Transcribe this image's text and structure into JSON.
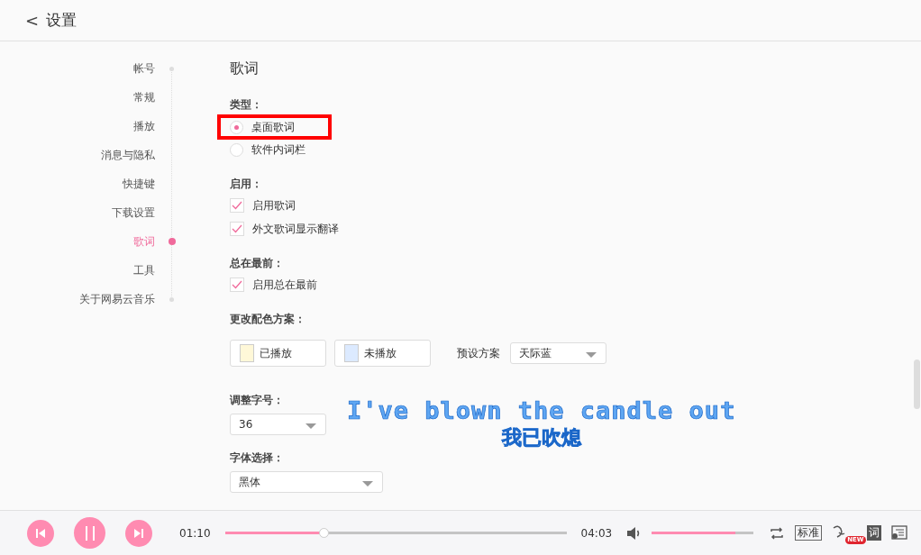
{
  "header": {
    "back": "<",
    "title": "设置"
  },
  "sidebar": {
    "items": [
      {
        "label": "帐号",
        "selected": false
      },
      {
        "label": "常规",
        "selected": false
      },
      {
        "label": "播放",
        "selected": false
      },
      {
        "label": "消息与隐私",
        "selected": false
      },
      {
        "label": "快捷键",
        "selected": false
      },
      {
        "label": "下载设置",
        "selected": false
      },
      {
        "label": "歌词",
        "selected": true
      },
      {
        "label": "工具",
        "selected": false
      },
      {
        "label": "关于网易云音乐",
        "selected": false
      }
    ]
  },
  "section_title": "歌词",
  "type_group": {
    "label": "类型：",
    "options": [
      {
        "label": "桌面歌词",
        "selected": true,
        "highlighted": true
      },
      {
        "label": "软件内词栏",
        "selected": false,
        "highlighted": false
      }
    ]
  },
  "enable_group": {
    "label": "启用：",
    "options": [
      {
        "label": "启用歌词",
        "checked": true
      },
      {
        "label": "外文歌词显示翻译",
        "checked": true
      }
    ]
  },
  "ontop_group": {
    "label": "总在最前：",
    "options": [
      {
        "label": "启用总在最前",
        "checked": true
      }
    ]
  },
  "color_group": {
    "label": "更改配色方案：",
    "swatches": [
      {
        "label": "已播放",
        "color": "#fff8d8"
      },
      {
        "label": "未播放",
        "color": "#dceaff"
      }
    ],
    "preset_label": "预设方案",
    "preset_value": "天际蓝"
  },
  "size_group": {
    "label": "调整字号：",
    "value": "36"
  },
  "font_group": {
    "label": "字体选择：",
    "value": "黑体"
  },
  "desktop_lyrics": {
    "line_1": "I've blown the candle out",
    "line_2": "我已吹熄"
  },
  "player": {
    "elapsed": "01:10",
    "level": 0.29,
    "total": "04:03",
    "volume": {
      "level": 0.82
    },
    "quality": "标准",
    "new_badge": "NEW",
    "lyrics_button": "词"
  }
}
